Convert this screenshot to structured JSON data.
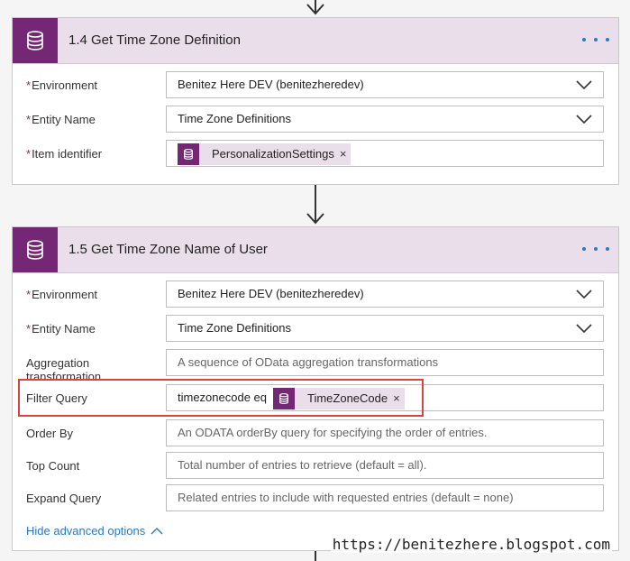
{
  "card1": {
    "title": "1.4 Get Time Zone Definition",
    "fields": {
      "environment": {
        "required": "*",
        "label": "Environment",
        "value": "Benitez Here DEV (benitezheredev)"
      },
      "entity_name": {
        "required": "*",
        "label": "Entity Name",
        "value": "Time Zone Definitions"
      },
      "item_identifier": {
        "required": "*",
        "label": "Item identifier",
        "token": "PersonalizationSettings",
        "token_close": "×"
      }
    }
  },
  "card2": {
    "title": "1.5 Get Time Zone Name of User",
    "fields": {
      "environment": {
        "required": "*",
        "label": "Environment",
        "value": "Benitez Here DEV (benitezheredev)"
      },
      "entity_name": {
        "required": "*",
        "label": "Entity Name",
        "value": "Time Zone Definitions"
      },
      "aggregation": {
        "label": "Aggregation transformation",
        "placeholder": "A sequence of OData aggregation transformations"
      },
      "filter_query": {
        "label": "Filter Query",
        "prefix": "timezonecode eq",
        "token": "TimeZoneCode",
        "token_close": "×"
      },
      "order_by": {
        "label": "Order By",
        "placeholder": "An ODATA orderBy query for specifying the order of entries."
      },
      "top_count": {
        "label": "Top Count",
        "placeholder": "Total number of entries to retrieve (default = all)."
      },
      "expand_query": {
        "label": "Expand Query",
        "placeholder": "Related entries to include with requested entries (default = none)"
      }
    },
    "hide_advanced": "Hide advanced options"
  },
  "watermark": "https://benitezhere.blogspot.com",
  "colors": {
    "connector": "#742774",
    "header_bg": "#eadeea",
    "link": "#2b78c5",
    "highlight": "#d9453c",
    "required": "#a4262c"
  },
  "icons": {
    "connector": "database-icon",
    "more": "ellipsis-icon",
    "dropdown": "chevron-down-icon",
    "arrow": "arrow-down-icon",
    "collapse": "chevron-up-icon"
  }
}
